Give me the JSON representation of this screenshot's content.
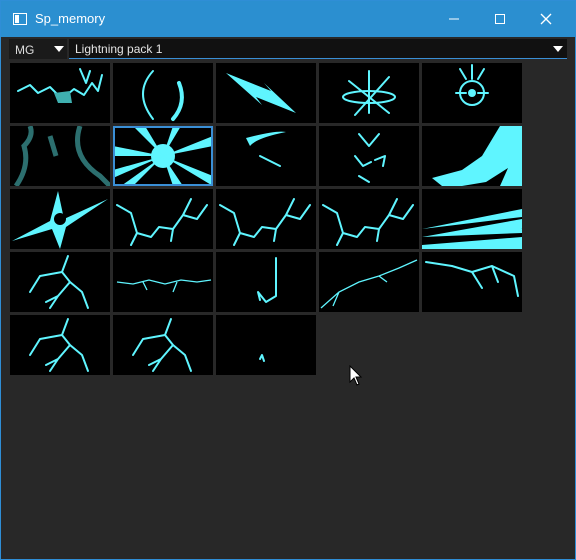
{
  "window": {
    "title": "Sp_memory",
    "accent": "#2b8fd0",
    "effect_color": "#5ff5ff"
  },
  "toolbar": {
    "category": "MG",
    "pack": "Lightning pack 1"
  },
  "thumbnails": [
    {
      "icon": "splash-lightning-icon"
    },
    {
      "icon": "arc-crescent-icon"
    },
    {
      "icon": "lightning-bolt-icon"
    },
    {
      "icon": "spark-burst-icon"
    },
    {
      "icon": "eye-orb-icon"
    },
    {
      "icon": "dark-smoke-icon"
    },
    {
      "icon": "radial-rays-icon",
      "selected": true
    },
    {
      "icon": "slash-streak-icon"
    },
    {
      "icon": "electric-sparks-icon"
    },
    {
      "icon": "splash-wave-icon"
    },
    {
      "icon": "star-flash-icon"
    },
    {
      "icon": "branch-lightning-icon"
    },
    {
      "icon": "branch-lightning-icon"
    },
    {
      "icon": "branch-lightning-icon"
    },
    {
      "icon": "beam-rays-icon"
    },
    {
      "icon": "forked-lightning-icon"
    },
    {
      "icon": "horizontal-lightning-icon"
    },
    {
      "icon": "hook-lightning-icon"
    },
    {
      "icon": "long-lightning-icon"
    },
    {
      "icon": "wide-lightning-icon"
    },
    {
      "icon": "forked-lightning-icon"
    },
    {
      "icon": "forked-lightning-icon"
    },
    {
      "icon": "small-spark-icon"
    }
  ]
}
